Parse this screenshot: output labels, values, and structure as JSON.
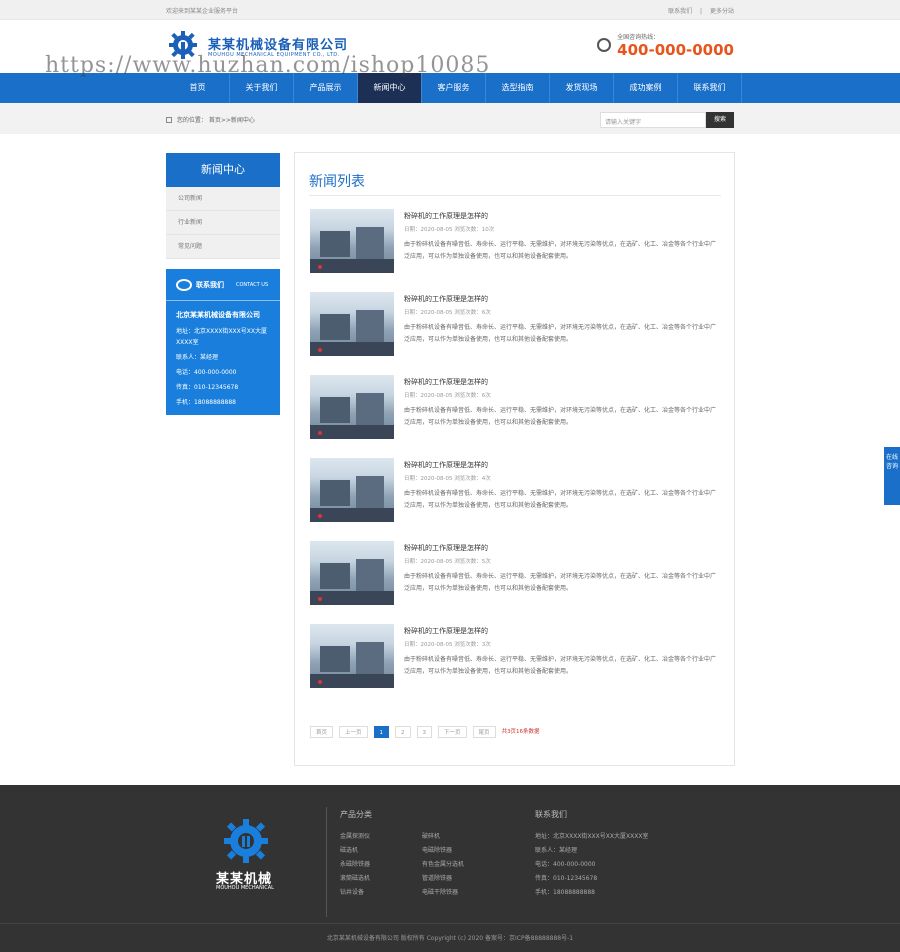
{
  "topbar": {
    "welcome": "欢迎来到某某企业服务平台",
    "link_contact": "联系我们",
    "link_more": "更多分站"
  },
  "header": {
    "company_name": "某某机械设备有限公司",
    "company_en": "MOUHOU MECHANICAL EQUIPMENT CO., LTD.",
    "watermark": "https://www.huzhan.com/ishop10085",
    "hotline_label": "全国咨询热线：",
    "hotline_number": "400-000-0000"
  },
  "nav": {
    "items": [
      "首页",
      "关于我们",
      "产品展示",
      "新闻中心",
      "客户服务",
      "选型指南",
      "发货现场",
      "成功案例",
      "联系我们"
    ],
    "active_index": 3
  },
  "breadcrumb": {
    "label": "您的位置：",
    "path": "首页>>新闻中心"
  },
  "search": {
    "placeholder": "请输入关键字",
    "button": "搜索"
  },
  "sidebar": {
    "title": "新闻中心",
    "items": [
      "公司新闻",
      "行业新闻",
      "常见问题"
    ],
    "contact": {
      "title": "联系我们",
      "title_en": "CONTACT US",
      "company": "北京某某机械设备有限公司",
      "address": "地址：北京XXXX街XXX号XX大厦XXXX室",
      "contact_person": "联系人：某经理",
      "phone": "电话：400-000-0000",
      "fax": "传真：010-12345678",
      "mobile": "手机：18088888888"
    }
  },
  "main": {
    "title": "新闻列表",
    "news": [
      {
        "title": "粉碎机的工作原理是怎样的",
        "meta": "日期：2020-08-05    浏览次数：10次",
        "desc": "由于粉碎机设备有噪音低、寿命长、运行平稳、无需维护，对环境无污染等优点，在选矿、化工、冶金等各个行业中广泛应用，可以作为单独设备使用，也可以和其他设备配套使用。"
      },
      {
        "title": "粉碎机的工作原理是怎样的",
        "meta": "日期：2020-08-05    浏览次数：6次",
        "desc": "由于粉碎机设备有噪音低、寿命长、运行平稳、无需维护，对环境无污染等优点，在选矿、化工、冶金等各个行业中广泛应用，可以作为单独设备使用，也可以和其他设备配套使用。"
      },
      {
        "title": "粉碎机的工作原理是怎样的",
        "meta": "日期：2020-08-05    浏览次数：6次",
        "desc": "由于粉碎机设备有噪音低、寿命长、运行平稳、无需维护，对环境无污染等优点，在选矿、化工、冶金等各个行业中广泛应用，可以作为单独设备使用，也可以和其他设备配套使用。"
      },
      {
        "title": "粉碎机的工作原理是怎样的",
        "meta": "日期：2020-08-05    浏览次数：4次",
        "desc": "由于粉碎机设备有噪音低、寿命长、运行平稳、无需维护，对环境无污染等优点，在选矿、化工、冶金等各个行业中广泛应用，可以作为单独设备使用，也可以和其他设备配套使用。"
      },
      {
        "title": "粉碎机的工作原理是怎样的",
        "meta": "日期：2020-08-05    浏览次数：5次",
        "desc": "由于粉碎机设备有噪音低、寿命长、运行平稳、无需维护，对环境无污染等优点，在选矿、化工、冶金等各个行业中广泛应用，可以作为单独设备使用，也可以和其他设备配套使用。"
      },
      {
        "title": "粉碎机的工作原理是怎样的",
        "meta": "日期：2020-08-05    浏览次数：3次",
        "desc": "由于粉碎机设备有噪音低、寿命长、运行平稳、无需维护，对环境无污染等优点，在选矿、化工、冶金等各个行业中广泛应用，可以作为单独设备使用，也可以和其他设备配套使用。"
      }
    ],
    "pager": {
      "first": "首页",
      "prev": "上一页",
      "pages": [
        "1",
        "2",
        "3"
      ],
      "next": "下一页",
      "last": "尾页",
      "info": "共3页16条数据"
    }
  },
  "float_tab": "在线咨询",
  "footer": {
    "brand": "某某机械",
    "brand_en": "MOUHOU MECHANICAL",
    "products_title": "产品分类",
    "products_col1": [
      "金属探测仪",
      "磁选机",
      "永磁除铁器",
      "滚筒磁选机",
      "钻井设备"
    ],
    "products_col2": [
      "破碎机",
      "电磁除铁器",
      "有色金属分选机",
      "管道除铁器",
      "电磁干除铁器"
    ],
    "contact_title": "联系我们",
    "contact_lines": [
      "地址：北京XXXX街XXX号XX大厦XXXX室",
      "联系人：某经理",
      "电话：400-000-0000",
      "传真：010-12345678",
      "手机：18088888888"
    ],
    "copyright": "北京某某机械设备有限公司 版权所有 Copyright (c) 2020 备案号：京ICP备88888888号-1"
  },
  "colors": {
    "brand_blue": "#1a6fc9",
    "nav_active": "#1c2f55",
    "hotline_orange": "#e8541c",
    "footer_bg": "#333333"
  }
}
